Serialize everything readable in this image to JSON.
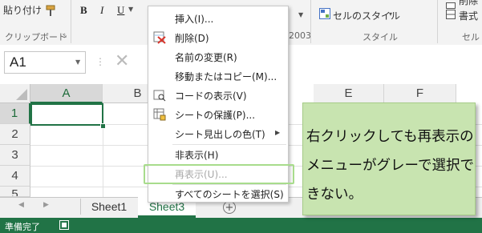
{
  "ribbon": {
    "paste_label": "貼り付け",
    "bold": "B",
    "italic": "I",
    "underline": "U",
    "cell_style_label": "セルのスタイル",
    "format_label": "書式",
    "delete_label": "削除",
    "clipboard_group": "クリップボード",
    "year_text": "2003",
    "style_group": "スタイル",
    "cell_group": "セル"
  },
  "formula_bar": {
    "name_box": "A1",
    "cancel_glyph": "✕"
  },
  "grid": {
    "columns": [
      "A",
      "B",
      "E",
      "F"
    ],
    "rows": [
      "1",
      "2",
      "3",
      "4",
      "5"
    ],
    "active_cell": "A1"
  },
  "context_menu": {
    "items": [
      {
        "label": "挿入(I)...",
        "disabled": false
      },
      {
        "label": "削除(D)",
        "disabled": false
      },
      {
        "label": "名前の変更(R)",
        "disabled": false
      },
      {
        "label": "移動またはコピー(M)...",
        "disabled": false
      },
      {
        "label": "コードの表示(V)",
        "disabled": false
      },
      {
        "label": "シートの保護(P)...",
        "disabled": false
      },
      {
        "label": "シート見出しの色(T)",
        "disabled": false
      },
      {
        "label": "非表示(H)",
        "disabled": false
      },
      {
        "label": "再表示(U)...",
        "disabled": true
      },
      {
        "label": "すべてのシートを選択(S)",
        "disabled": false
      }
    ]
  },
  "tabs": {
    "sheets": [
      "Sheet1",
      "Sheet3"
    ],
    "active": "Sheet3",
    "add_glyph": "+"
  },
  "status": {
    "text": "準備完了"
  },
  "callout": {
    "text": "右クリックしても再表示のメニューがグレーで選択できない。"
  },
  "colors": {
    "accent_green": "#217346",
    "callout_bg": "#c8e4b0",
    "highlight_border": "#a8dc8c"
  }
}
